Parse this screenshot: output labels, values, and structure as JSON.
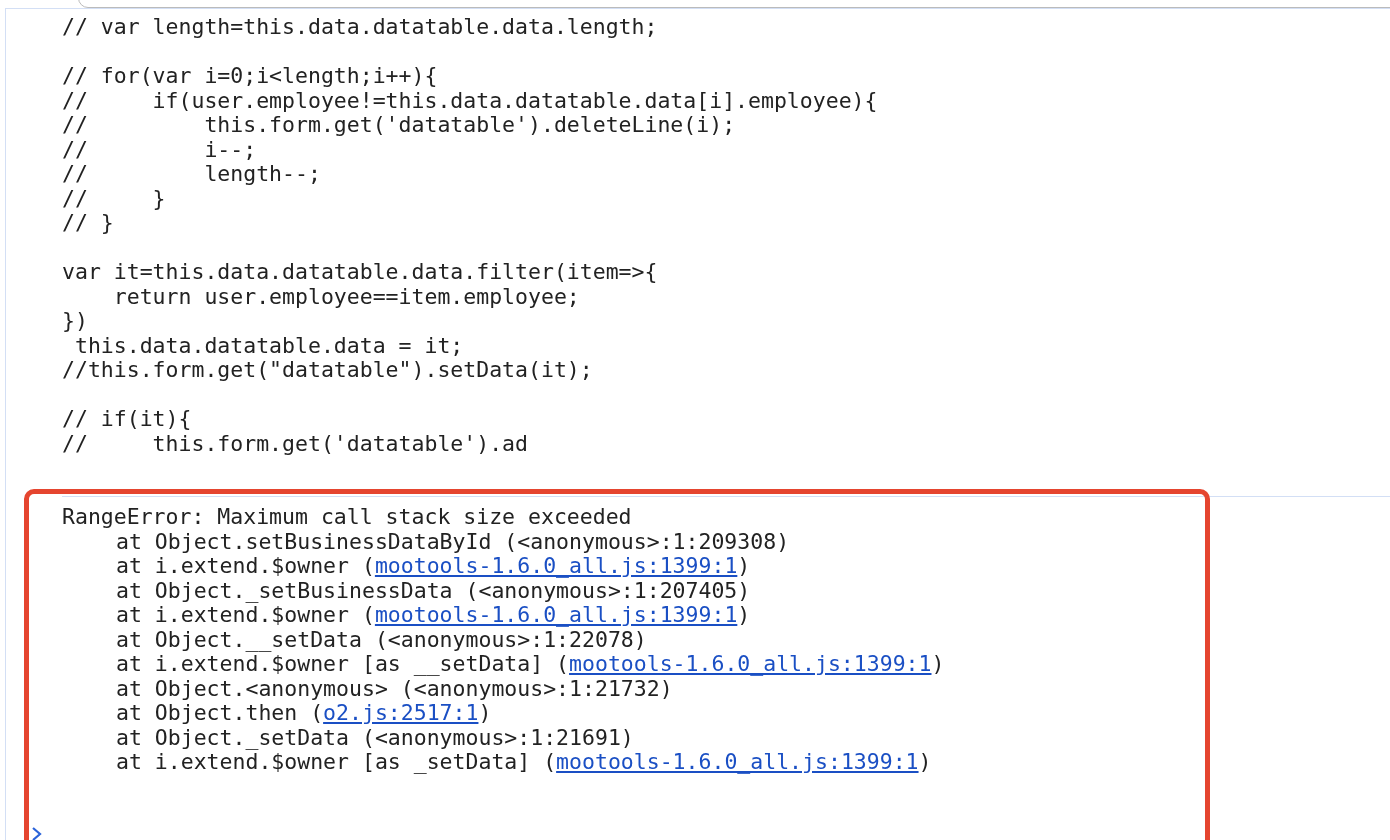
{
  "code_blocks": [
    [
      "// var length=this.data.datatable.data.length;"
    ],
    [
      "// for(var i=0;i<length;i++){",
      "//     if(user.employee!=this.data.datatable.data[i].employee){",
      "//         this.form.get('datatable').deleteLine(i);",
      "//         i--;",
      "//         length--;",
      "//     }",
      "// }"
    ],
    [
      "var it=this.data.datatable.data.filter(item=>{",
      "    return user.employee==item.employee;",
      "})",
      " this.data.datatable.data = it;",
      "//this.form.get(\"datatable\").setData(it);"
    ],
    [
      "// if(it){",
      "//     this.form.get('datatable').ad"
    ]
  ],
  "error": {
    "message": "RangeError: Maximum call stack size exceeded",
    "frames": [
      {
        "text": "at Object.setBusinessDataById (<anonymous>:1:209308)"
      },
      {
        "text": "at i.extend.$owner (",
        "link": "mootools-1.6.0_all.js:1399:1",
        "suffix": ")"
      },
      {
        "text": "at Object._setBusinessData (<anonymous>:1:207405)"
      },
      {
        "text": "at i.extend.$owner (",
        "link": "mootools-1.6.0_all.js:1399:1",
        "suffix": ")"
      },
      {
        "text": "at Object.__setData (<anonymous>:1:22078)"
      },
      {
        "text": "at i.extend.$owner [as __setData] (",
        "link": "mootools-1.6.0_all.js:1399:1",
        "suffix": ")"
      },
      {
        "text": "at Object.<anonymous> (<anonymous>:1:21732)"
      },
      {
        "text": "at Object.then (",
        "link": "o2.js:2517:1",
        "suffix": ")"
      },
      {
        "text": "at Object._setData (<anonymous>:1:21691)"
      },
      {
        "text": "at i.extend.$owner [as _setData] (",
        "link": "mootools-1.6.0_all.js:1399:1",
        "suffix": ")"
      }
    ]
  }
}
